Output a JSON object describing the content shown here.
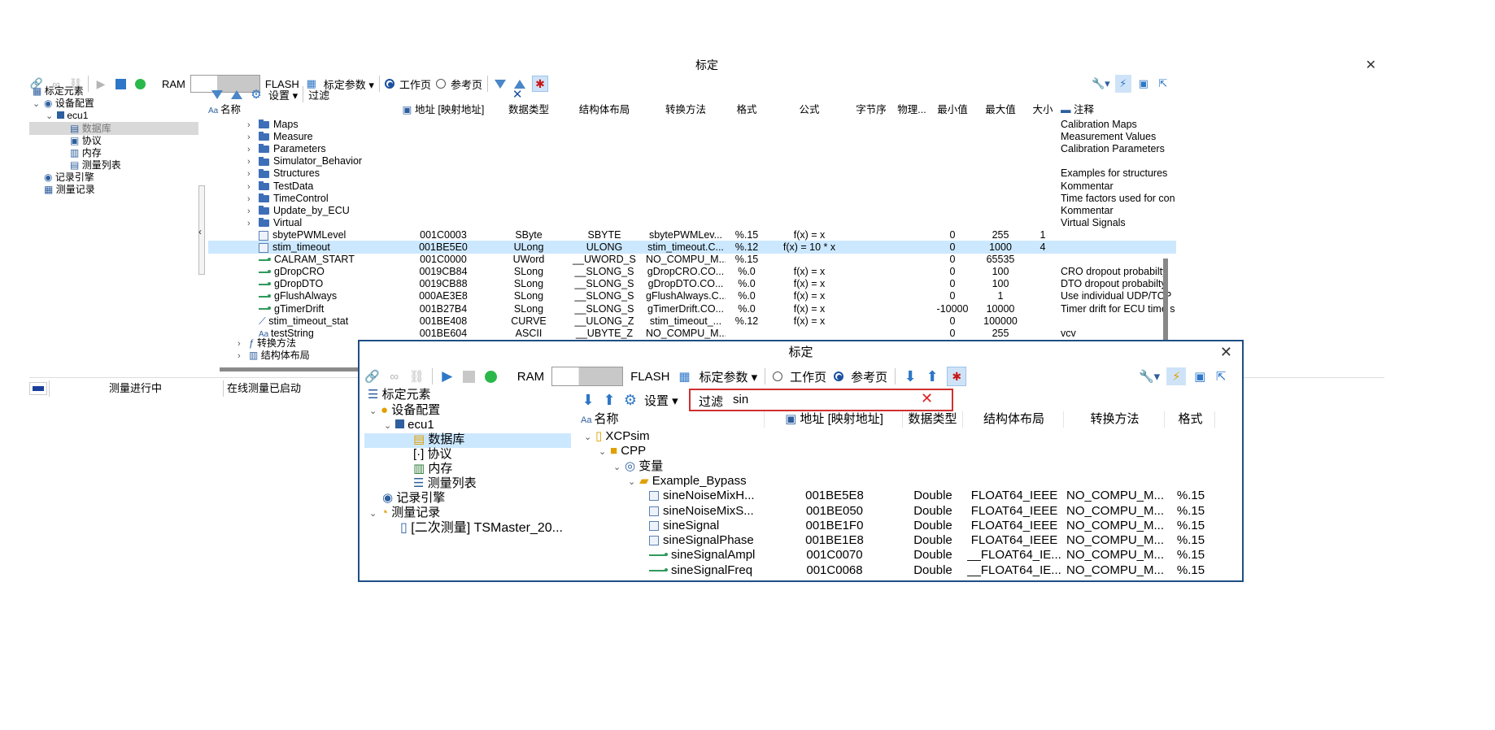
{
  "main_window": {
    "title": "标定",
    "toolbar": {
      "ram_label": "RAM",
      "flash_label": "FLASH",
      "calib_params_label": "标定参数",
      "working_page_label": "工作页",
      "reference_page_label": "参考页"
    },
    "tree": {
      "root": "标定元素",
      "device_config": "设备配置",
      "ecu": "ecu1",
      "database": "数据库",
      "protocol": "协议",
      "memory": "内存",
      "measurement_list": "测量列表",
      "recorder": "记录引擎",
      "measurement_records": "测量记录"
    },
    "grid_toolbar": {
      "settings_label": "设置",
      "filter_label": "过滤"
    },
    "columns": [
      "名称",
      "地址 [映射地址]",
      "数据类型",
      "结构体布局",
      "转换方法",
      "格式",
      "公式",
      "字节序",
      "物理...",
      "最小值",
      "最大值",
      "大小",
      "注释"
    ],
    "folders": [
      {
        "name": "Maps",
        "note": "Calibration Maps"
      },
      {
        "name": "Measure",
        "note": "Measurement Values"
      },
      {
        "name": "Parameters",
        "note": "Calibration Parameters"
      },
      {
        "name": "Simulator_Behavior",
        "note": ""
      },
      {
        "name": "Structures",
        "note": "Examples for structures"
      },
      {
        "name": "TestData",
        "note": "Kommentar"
      },
      {
        "name": "TimeControl",
        "note": "Time factors used for con"
      },
      {
        "name": "Update_by_ECU",
        "note": "Kommentar"
      },
      {
        "name": "Virtual",
        "note": "Virtual Signals"
      }
    ],
    "rows": [
      {
        "name": "sbytePWMLevel",
        "addr": "001C0003",
        "type": "SByte",
        "layout": "SBYTE",
        "conv": "sbytePWMLev...",
        "fmt": "%.15",
        "formula": "f(x) = x",
        "min": "0",
        "max": "255",
        "size": "1",
        "note": ""
      },
      {
        "name": "stim_timeout",
        "addr": "001BE5E0",
        "type": "ULong",
        "layout": "ULONG",
        "conv": "stim_timeout.C...",
        "fmt": "%.12",
        "formula": "f(x) = 10 * x",
        "min": "0",
        "max": "1000",
        "size": "4",
        "note": ""
      },
      {
        "name": "CALRAM_START",
        "addr": "001C0000",
        "type": "UWord",
        "layout": "__UWORD_S",
        "conv": "NO_COMPU_M...",
        "fmt": "%.15",
        "formula": "",
        "min": "0",
        "max": "65535",
        "size": "",
        "note": ""
      },
      {
        "name": "gDropCRO",
        "addr": "0019CB84",
        "type": "SLong",
        "layout": "__SLONG_S",
        "conv": "gDropCRO.CO...",
        "fmt": "%.0",
        "formula": "f(x) = x",
        "min": "0",
        "max": "100",
        "size": "",
        "note": "CRO dropout probabilty"
      },
      {
        "name": "gDropDTO",
        "addr": "0019CB88",
        "type": "SLong",
        "layout": "__SLONG_S",
        "conv": "gDropDTO.CO...",
        "fmt": "%.0",
        "formula": "f(x) = x",
        "min": "0",
        "max": "100",
        "size": "",
        "note": "DTO dropout probabilty"
      },
      {
        "name": "gFlushAlways",
        "addr": "000AE3E8",
        "type": "SLong",
        "layout": "__SLONG_S",
        "conv": "gFlushAlways.C...",
        "fmt": "%.0",
        "formula": "f(x) = x",
        "min": "0",
        "max": "1",
        "size": "",
        "note": "Use individual UDP/TCP pa"
      },
      {
        "name": "gTimerDrift",
        "addr": "001B27B4",
        "type": "SLong",
        "layout": "__SLONG_S",
        "conv": "gTimerDrift.CO...",
        "fmt": "%.0",
        "formula": "f(x) = x",
        "min": "-10000",
        "max": "10000",
        "size": "",
        "note": "Timer drift for ECU time st"
      },
      {
        "name": "stim_timeout_stat",
        "addr": "001BE408",
        "type": "CURVE",
        "layout": "__ULONG_Z",
        "conv": "stim_timeout_...",
        "fmt": "%.12",
        "formula": "f(x) = x",
        "min": "0",
        "max": "100000",
        "size": "",
        "note": ""
      },
      {
        "name": "testString",
        "addr": "001BE604",
        "type": "ASCII",
        "layout": "__UBYTE_Z",
        "conv": "NO_COMPU_M...",
        "fmt": "",
        "formula": "",
        "min": "0",
        "max": "255",
        "size": "",
        "note": "vcv"
      }
    ],
    "trailing_tree": {
      "conversion_methods": "转换方法",
      "struct_layouts": "结构体布局"
    },
    "status": {
      "measuring": "测量进行中",
      "online_started": "在线测量已启动"
    }
  },
  "inset_window": {
    "title": "标定",
    "toolbar": {
      "ram_label": "RAM",
      "flash_label": "FLASH",
      "calib_params_label": "标定参数",
      "working_page_label": "工作页",
      "reference_page_label": "参考页"
    },
    "tree": {
      "root": "标定元素",
      "device_config": "设备配置",
      "ecu": "ecu1",
      "database": "数据库",
      "protocol": "协议",
      "memory": "内存",
      "measurement_list": "测量列表",
      "recorder": "记录引擎",
      "measurement_records": "测量记录",
      "record_item": "[二次测量] TSMaster_20..."
    },
    "grid_toolbar": {
      "settings_label": "设置",
      "filter_label": "过滤",
      "filter_value": "sin"
    },
    "columns": [
      "名称",
      "地址 [映射地址]",
      "数据类型",
      "结构体布局",
      "转换方法",
      "格式"
    ],
    "tree_nodes": {
      "xcp": "XCPsim",
      "cpp": "CPP",
      "variables": "变量",
      "group": "Example_Bypass"
    },
    "rows": [
      {
        "name": "sineNoiseMixH...",
        "addr": "001BE5E8",
        "type": "Double",
        "layout": "FLOAT64_IEEE",
        "conv": "NO_COMPU_M...",
        "fmt": "%.15"
      },
      {
        "name": "sineNoiseMixS...",
        "addr": "001BE050",
        "type": "Double",
        "layout": "FLOAT64_IEEE",
        "conv": "NO_COMPU_M...",
        "fmt": "%.15"
      },
      {
        "name": "sineSignal",
        "addr": "001BE1F0",
        "type": "Double",
        "layout": "FLOAT64_IEEE",
        "conv": "NO_COMPU_M...",
        "fmt": "%.15"
      },
      {
        "name": "sineSignalPhase",
        "addr": "001BE1E8",
        "type": "Double",
        "layout": "FLOAT64_IEEE",
        "conv": "NO_COMPU_M...",
        "fmt": "%.15"
      },
      {
        "name": "sineSignalAmpl",
        "addr": "001C0070",
        "type": "Double",
        "layout": "__FLOAT64_IE...",
        "conv": "NO_COMPU_M...",
        "fmt": "%.15"
      },
      {
        "name": "sineSignalFreq",
        "addr": "001C0068",
        "type": "Double",
        "layout": "__FLOAT64_IE...",
        "conv": "NO_COMPU_M...",
        "fmt": "%.15"
      }
    ]
  },
  "colors": {
    "accent": "#1a4fa0",
    "selection": "#cce8ff",
    "inset_border": "#1f4e86",
    "filter_highlight": "#d03030"
  }
}
